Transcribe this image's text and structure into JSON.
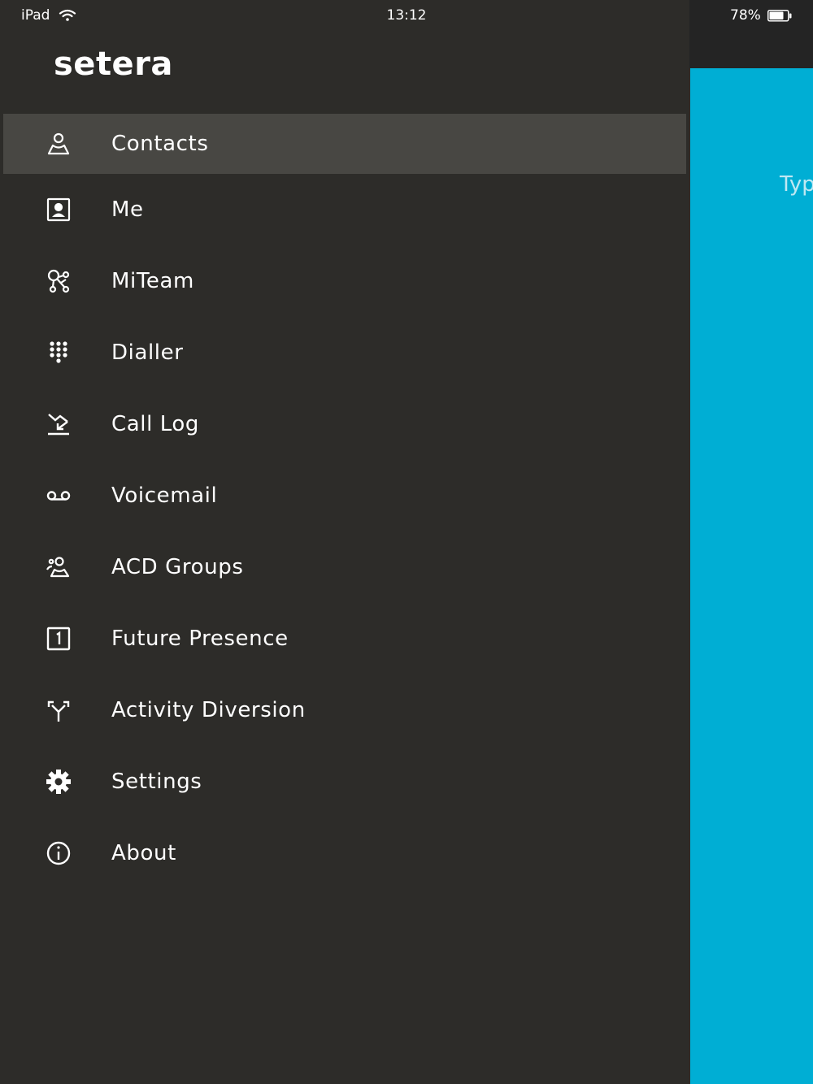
{
  "status_bar": {
    "device": "iPad",
    "time": "13:12",
    "battery_percent": "78%",
    "icons": [
      "wifi-icon",
      "battery-icon"
    ]
  },
  "app": {
    "logo_text": "setera"
  },
  "menu": {
    "active_index": 0,
    "items": [
      {
        "label": "Contacts",
        "icon": "contacts-icon"
      },
      {
        "label": "Me",
        "icon": "me-icon"
      },
      {
        "label": "MiTeam",
        "icon": "miteam-icon"
      },
      {
        "label": "Dialler",
        "icon": "dialpad-icon"
      },
      {
        "label": "Call Log",
        "icon": "call-log-icon"
      },
      {
        "label": "Voicemail",
        "icon": "voicemail-icon"
      },
      {
        "label": "ACD Groups",
        "icon": "acd-groups-icon"
      },
      {
        "label": "Future Presence",
        "icon": "calendar-icon"
      },
      {
        "label": "Activity Diversion",
        "icon": "diversion-icon"
      },
      {
        "label": "Settings",
        "icon": "gear-icon"
      },
      {
        "label": "About",
        "icon": "info-icon"
      }
    ]
  },
  "background_panel": {
    "hint_text": "Typ"
  },
  "colors": {
    "drawer_bg": "#2d2c29",
    "active_item_bg": "#484743",
    "accent": "#00aed4"
  }
}
